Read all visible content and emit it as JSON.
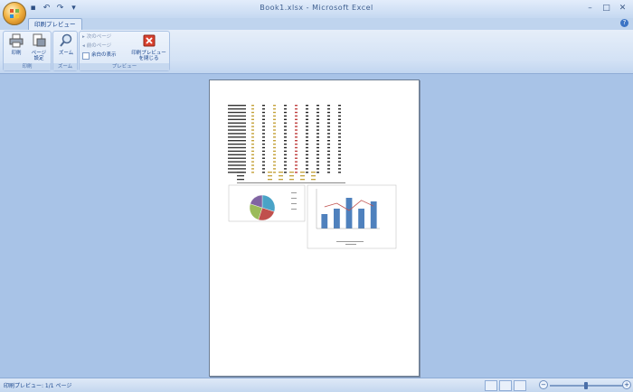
{
  "window": {
    "title": "Book1.xlsx - Microsoft Excel"
  },
  "qat": {
    "save_icon": "save-icon",
    "undo_icon": "undo-icon",
    "redo_icon": "redo-icon",
    "customize_icon": "dropdown-icon"
  },
  "tabs": {
    "print_preview": "印刷プレビュー"
  },
  "ribbon": {
    "print_group": {
      "label": "印刷",
      "print_label": "印刷",
      "page_setup_label": "ページ\n設定"
    },
    "zoom_group": {
      "label": "ズーム",
      "zoom_label": "ズーム"
    },
    "preview_group": {
      "label": "プレビュー",
      "next_page": "次のページ",
      "prev_page": "前のページ",
      "show_margins": "余白の表示",
      "close_label": "印刷プレビュー\nを閉じる"
    }
  },
  "status": {
    "text": "印刷プレビュー: 1/1 ページ",
    "zoom": ""
  },
  "colors": {
    "accent": "#15428b",
    "ribbon": "#d3e2f5",
    "workspace": "#a8c3e7"
  },
  "chart_data": [
    {
      "type": "pie",
      "title": "",
      "values": [
        30,
        25,
        25,
        20
      ],
      "colors": [
        "#4aa3c7",
        "#c0504d",
        "#9bbb59",
        "#8064a2"
      ]
    },
    {
      "type": "bar",
      "title": "",
      "values": [
        40,
        55,
        85,
        55,
        75
      ],
      "line": [
        60,
        70,
        50,
        78,
        62
      ],
      "bar_color": "#4f81bd",
      "line_color": "#c0504d"
    }
  ]
}
